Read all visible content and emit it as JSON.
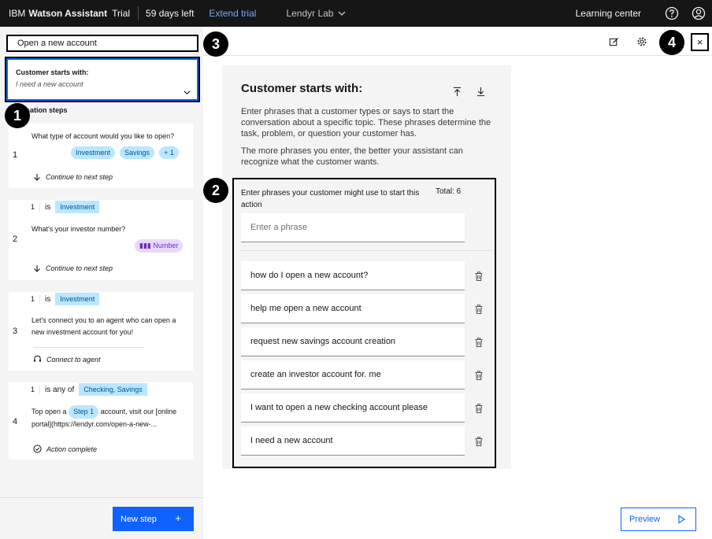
{
  "header": {
    "brand_ibm": "IBM",
    "brand_product": "Watson Assistant",
    "plan": "Trial",
    "days_left": "59 days left",
    "extend_trial": "Extend trial",
    "workspace": "Lendyr Lab",
    "learning_center": "Learning center"
  },
  "left": {
    "action_name": "Open a new account",
    "starts_card_title": "Customer starts with:",
    "starts_card_value": "I need a new account",
    "steps_title": "sation steps",
    "steps": [
      {
        "num": "1",
        "text": "What type of account would you like to open?",
        "tags": [
          "Investment",
          "Savings",
          "+ 1"
        ],
        "footer": "Continue to next step"
      },
      {
        "num": "2",
        "cond_num": "1",
        "cond_op": "is",
        "cond_val": "Investment",
        "text": "What's your investor number?",
        "tag": "Number",
        "footer": "Continue to next step"
      },
      {
        "num": "3",
        "cond_num": "1",
        "cond_op": "is",
        "cond_val": "Investment",
        "text": "Let's connect you to an agent who can open a new investment account for you!",
        "footer": "Connect to agent"
      },
      {
        "num": "4",
        "cond_num": "1",
        "cond_op": "is any of",
        "cond_val": "Checking, Savings",
        "text_a": "Top open a",
        "text_tag": "Step 1",
        "text_b": "account, visit our [online",
        "text_c": "portal](https://lendyr.com/open-a-new-...",
        "footer": "Action complete"
      }
    ],
    "new_step": "New step"
  },
  "center": {
    "title": "Customer starts with:",
    "desc1": "Enter phrases that a customer types or says to start the conversation about a specific topic. These phrases determine the task, problem, or question your customer has.",
    "desc2": "The more phrases you enter, the better your assistant can recognize what the customer wants.",
    "phrases_label": "Enter phrases your customer might use to start this action",
    "total": "Total: 6",
    "input_placeholder": "Enter a phrase",
    "phrases": [
      "how do I open a new account?",
      "help me open a new account",
      "request new savings account creation",
      "create an investor account for. me",
      "I want to open a new checking account please",
      "I need a new account"
    ]
  },
  "preview": "Preview",
  "badges": [
    "1",
    "2",
    "3",
    "4"
  ],
  "colors": {
    "header_bg": "#161616",
    "primary": "#0f62fe",
    "tag_bg": "#bae6ff",
    "tag_text": "#00539a",
    "panel_bg": "#f4f4f4",
    "link": "#78a9ff",
    "number_tag_bg": "#e8daff"
  }
}
